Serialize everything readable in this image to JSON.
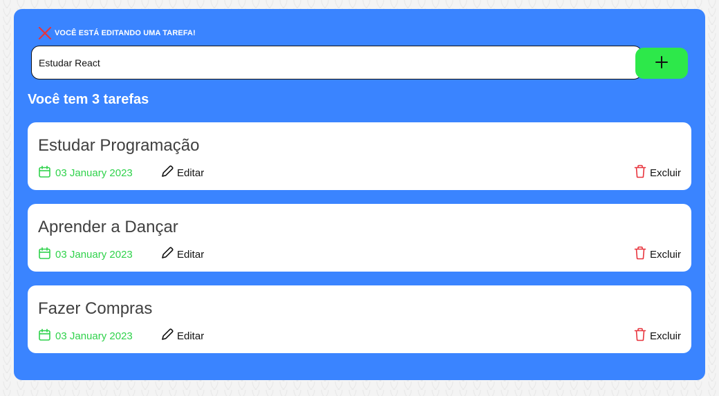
{
  "editing_notice": {
    "text": "VOCÊ ESTÁ EDITANDO UMA TAREFA!",
    "icon": "close-icon",
    "icon_color": "#e8333c"
  },
  "task_input": {
    "value": "Estudar React",
    "placeholder": ""
  },
  "add_button": {
    "icon": "plus-icon",
    "color": "#2de84a"
  },
  "summary": {
    "title": "Você tem 3 tarefas"
  },
  "tasks": [
    {
      "title": "Estudar Programação",
      "date": "03 January 2023",
      "edit_label": "Editar",
      "delete_label": "Excluir"
    },
    {
      "title": "Aprender a Dançar",
      "date": "03 January 2023",
      "edit_label": "Editar",
      "delete_label": "Excluir"
    },
    {
      "title": "Fazer Compras",
      "date": "03 January 2023",
      "edit_label": "Editar",
      "delete_label": "Excluir"
    }
  ],
  "colors": {
    "panel": "#3a84ff",
    "date": "#2fd24b",
    "delete_icon": "#e8333c"
  }
}
